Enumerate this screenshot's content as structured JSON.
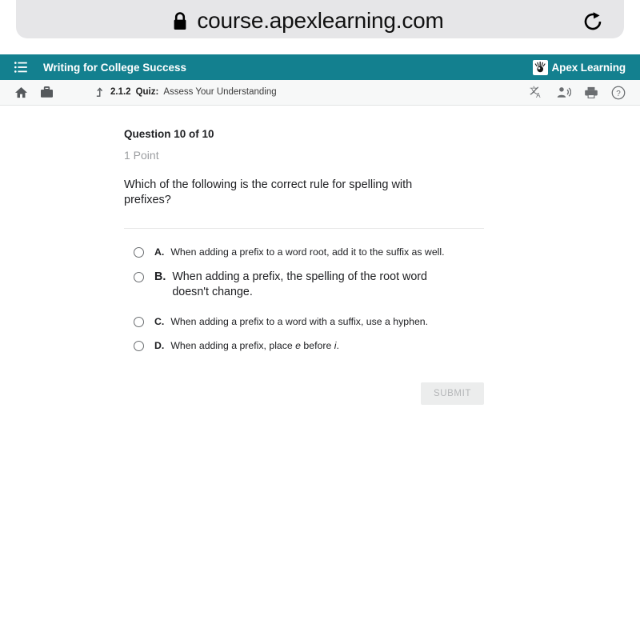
{
  "browser": {
    "url": "course.apexlearning.com",
    "lock_icon": "lock-icon",
    "reload_icon": "reload-icon"
  },
  "app_header": {
    "menu_icon": "hamburger-menu-icon",
    "course_title": "Writing for College Success",
    "brand_name": "Apex Learning",
    "brand_logo_icon": "apex-learning-logo-icon",
    "background_color": "#13808f"
  },
  "sub_header": {
    "home_icon": "home-icon",
    "briefcase_icon": "briefcase-icon",
    "up_arrow_icon": "up-level-arrow-icon",
    "breadcrumb": {
      "number": "2.1.2",
      "kind": "Quiz:",
      "name": "Assess Your Understanding"
    },
    "translate_icon": "translate-icon",
    "read_aloud_icon": "read-aloud-icon",
    "print_icon": "print-icon",
    "help_icon": "help-icon"
  },
  "question": {
    "counter": "Question 10 of 10",
    "points": "1 Point",
    "prompt": "Which of the following is the correct rule for spelling with prefixes?",
    "options": [
      {
        "letter": "A.",
        "text": "When adding a prefix to a word root, add it to the suffix as well.",
        "selected": false
      },
      {
        "letter": "B.",
        "text": "When adding a prefix, the spelling of the root word doesn't change.",
        "selected": false
      },
      {
        "letter": "C.",
        "text": "When adding a prefix to a word with a suffix, use a hyphen.",
        "selected": false
      },
      {
        "letter": "D.",
        "text_before": "When adding a prefix, place ",
        "italic_1": "e",
        "text_middle": " before ",
        "italic_2": "i",
        "text_after": ".",
        "selected": false
      }
    ]
  },
  "submit": {
    "label": "SUBMIT",
    "disabled": true
  }
}
